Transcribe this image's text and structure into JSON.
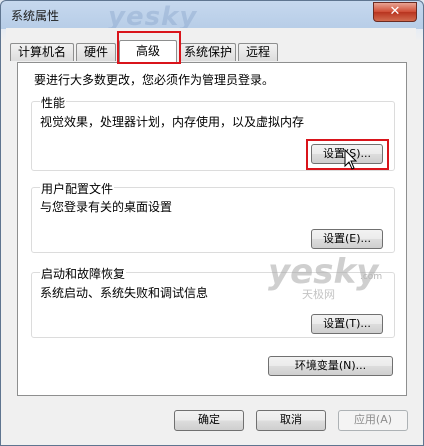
{
  "window": {
    "title": "系统属性",
    "close_symbol": "✕"
  },
  "watermark": {
    "top": "yesky",
    "mid": "yesky",
    "mid_com": ".com",
    "mid_sub": "天极网"
  },
  "tabs": [
    {
      "label": "计算机名"
    },
    {
      "label": "硬件"
    },
    {
      "label": "高级"
    },
    {
      "label": "系统保护"
    },
    {
      "label": "远程"
    }
  ],
  "notice": "要进行大多数更改，您必须作为管理员登录。",
  "performance": {
    "title": "性能",
    "desc": "视觉效果，处理器计划，内存使用，以及虚拟内存",
    "button": "设置(S)..."
  },
  "user_profiles": {
    "title": "用户配置文件",
    "desc": "与您登录有关的桌面设置",
    "button": "设置(E)..."
  },
  "startup": {
    "title": "启动和故障恢复",
    "desc": "系统启动、系统失败和调试信息",
    "button": "设置(T)..."
  },
  "env_button": "环境变量(N)...",
  "footer": {
    "ok": "确定",
    "cancel": "取消",
    "apply": "应用(A)"
  }
}
